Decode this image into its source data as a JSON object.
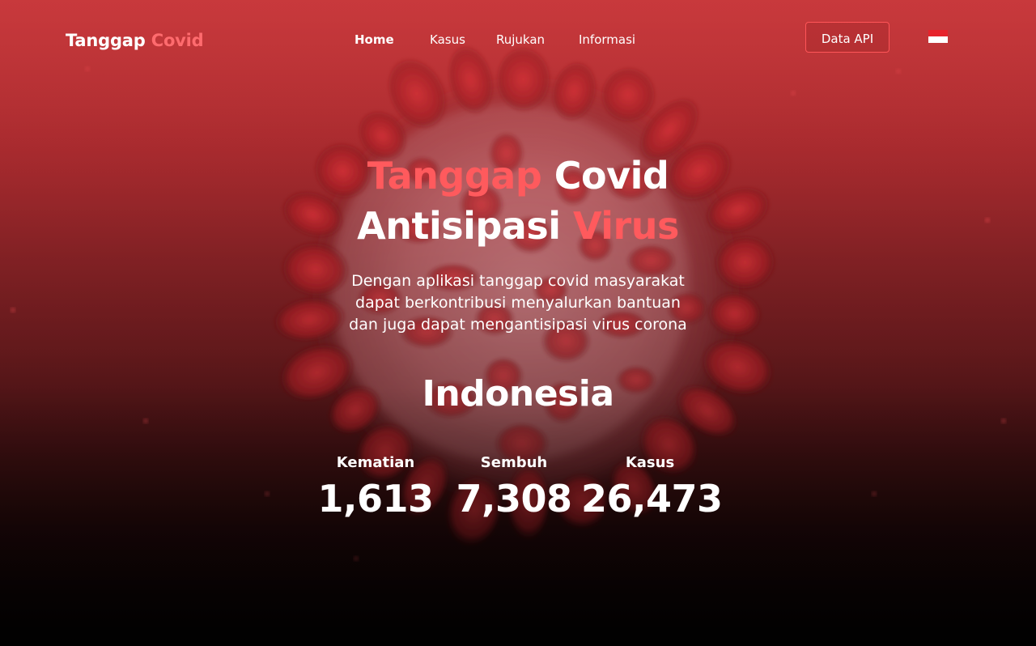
{
  "brand": {
    "part1": "Tanggap",
    "part2": "Covid"
  },
  "nav": {
    "items": [
      {
        "label": "Home",
        "active": true
      },
      {
        "label": "Kasus",
        "active": false
      },
      {
        "label": "Rujukan",
        "active": false
      },
      {
        "label": "Informasi",
        "active": false
      }
    ],
    "api_button": "Data API",
    "language_flag": "indonesia-flag-icon"
  },
  "hero": {
    "title_line1": {
      "part1": "Tanggap",
      "part2": "Covid"
    },
    "title_line2": {
      "part1": "Antisipasi",
      "part2": "Virus"
    },
    "description_lines": [
      "Dengan aplikasi tanggap covid masyarakat",
      "dapat berkontribusi menyalurkan bantuan",
      "dan juga dapat mengantisipasi virus corona"
    ]
  },
  "stats": {
    "country": "Indonesia",
    "items": [
      {
        "label": "Kematian",
        "value": "1,613"
      },
      {
        "label": "Sembuh",
        "value": "7,308"
      },
      {
        "label": "Kasus",
        "value": "26,473"
      }
    ]
  },
  "colors": {
    "accent": "#ff5a5d",
    "background_top": "#c83a3d",
    "background_bottom": "#070303",
    "flag_red": "#e6232c",
    "flag_white": "#ffffff"
  }
}
